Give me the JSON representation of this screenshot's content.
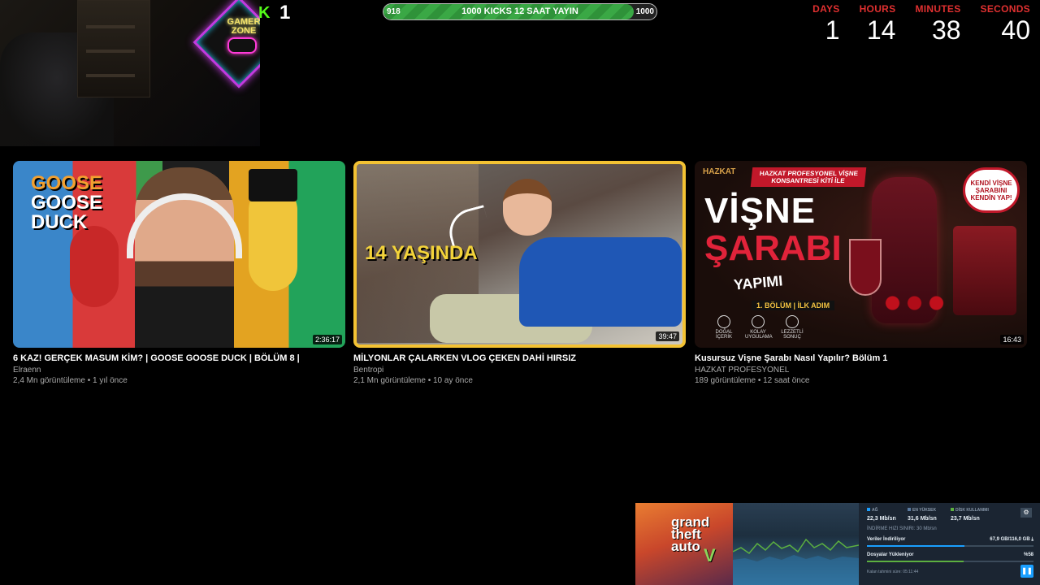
{
  "kick": {
    "count": "1"
  },
  "goal": {
    "current": "918",
    "label": "1000 KICKS 12 SAAT YAYIN",
    "target": "1000",
    "progress": 0.918
  },
  "countdown": [
    {
      "label": "DAYS",
      "value": "1"
    },
    {
      "label": "HOURS",
      "value": "14"
    },
    {
      "label": "MINUTES",
      "value": "38"
    },
    {
      "label": "SECONDS",
      "value": "40"
    }
  ],
  "webcam": {
    "sign_text": "GAMER ZONE"
  },
  "videos": [
    {
      "title": "6 KAZ! GERÇEK MASUM KİM? | GOOSE GOOSE DUCK | BÖLÜM 8 |",
      "channel": "Elraenn",
      "meta": "2,4 Mn görüntüleme • 1 yıl önce",
      "duration": "2:36:17",
      "thumb_text": [
        "GOOSE",
        "GOOSE",
        "DUCK"
      ]
    },
    {
      "title": "MİLYONLAR ÇALARKEN VLOG ÇEKEN DAHİ HIRSIZ",
      "channel": "Bentropi",
      "meta": "2,1 Mn görüntüleme • 10 ay önce",
      "duration": "39:47",
      "thumb_text": "14 YAŞINDA"
    },
    {
      "title": "Kusursuz Vişne Şarabı Nasıl Yapılır? Bölüm 1",
      "channel": "HAZKAT PROFESYONEL",
      "meta": "189 görüntüleme • 12 saat önce",
      "duration": "16:43",
      "thumb_text": {
        "brand": "HAZKAT",
        "banner": "HAZKAT PROFESYONEL VİŞNE KONSANTRESİ KİTİ İLE",
        "line1": "VİŞNE",
        "line2": "ŞARABI",
        "line3": "YAPIMI",
        "line4": "1. BÖLÜM | İLK ADIM",
        "bubble": "KENDİ VİŞNE ŞARABINI KENDİN YAP!",
        "icons": [
          "DOĞAL İÇERİK",
          "KOLAY UYGULAMA",
          "LEZZETLİ SONUÇ"
        ]
      }
    }
  ],
  "steam": {
    "game_logo": "grand theft auto",
    "game_logo_v": "V",
    "stats": [
      {
        "label": "AĞ",
        "value": "22,3 Mb/sn",
        "color": "#1a9fff"
      },
      {
        "label": "EN YÜKSEK",
        "value": "31,6 Mb/sn",
        "color": "#5a7aa0"
      },
      {
        "label": "DİSK KULLANIMI",
        "value": "23,7 Mb/sn",
        "color": "#5cb040"
      }
    ],
    "limit": "İNDİRME HIZI SINIRI: 30 Mb/sn",
    "downloading_label": "Veriler İndiriliyor",
    "downloading_value": "67,9 GB/116,0 GB",
    "downloading_progress": 0.585,
    "files_label": "Dosyalar Yükleniyor",
    "files_value": "%58",
    "files_progress": 0.58,
    "eta": "Kalan tahmini süre: 05:11:44"
  }
}
